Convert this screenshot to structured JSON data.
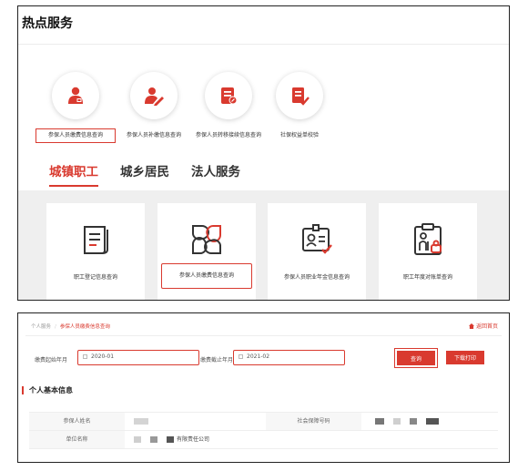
{
  "hot": {
    "title": "热点服务",
    "services": [
      {
        "label": "参保人员缴费信息查询",
        "icon": "person-id-icon"
      },
      {
        "label": "参保人员补缴信息查询",
        "icon": "person-edit-icon"
      },
      {
        "label": "参保人员转移接续信息查询",
        "icon": "document-edit-icon"
      },
      {
        "label": "社保权益单校验",
        "icon": "document-check-icon"
      }
    ]
  },
  "tabs": [
    "城镇职工",
    "城乡居民",
    "法人服务"
  ],
  "cards": [
    {
      "label": "职工登记信息查询",
      "icon": "scroll-document-icon"
    },
    {
      "label": "参保人员缴费信息查询",
      "icon": "four-petals-icon"
    },
    {
      "label": "参保人员职业年金信息查询",
      "icon": "id-card-check-icon"
    },
    {
      "label": "职工年度对账单查询",
      "icon": "elder-clipboard-icon"
    }
  ],
  "query": {
    "breadcrumb": {
      "root": "个人服务",
      "sep": "/",
      "current": "参保人员缴费信息查询"
    },
    "back_home": "返回首页",
    "start_label": "缴费起始年月",
    "start_value": "2020-01",
    "end_label": "缴费截止年月",
    "end_value": "2021-02",
    "query_btn": "查询",
    "download_btn": "下载打印",
    "section_title": "个人基本信息",
    "fields": {
      "name_label": "参保人姓名",
      "ssn_label": "社会保障号码",
      "company_label": "单位名称",
      "company_suffix": "有限责任公司"
    }
  },
  "colors": {
    "accent": "#d93a2f"
  }
}
